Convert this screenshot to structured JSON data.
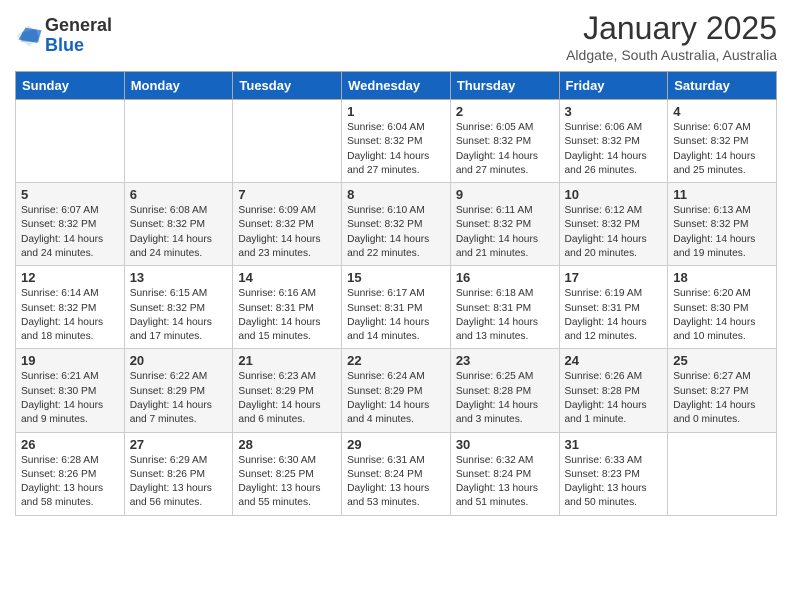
{
  "header": {
    "logo_general": "General",
    "logo_blue": "Blue",
    "month_title": "January 2025",
    "location": "Aldgate, South Australia, Australia"
  },
  "weekdays": [
    "Sunday",
    "Monday",
    "Tuesday",
    "Wednesday",
    "Thursday",
    "Friday",
    "Saturday"
  ],
  "weeks": [
    [
      {
        "day": "",
        "info": ""
      },
      {
        "day": "",
        "info": ""
      },
      {
        "day": "",
        "info": ""
      },
      {
        "day": "1",
        "info": "Sunrise: 6:04 AM\nSunset: 8:32 PM\nDaylight: 14 hours\nand 27 minutes."
      },
      {
        "day": "2",
        "info": "Sunrise: 6:05 AM\nSunset: 8:32 PM\nDaylight: 14 hours\nand 27 minutes."
      },
      {
        "day": "3",
        "info": "Sunrise: 6:06 AM\nSunset: 8:32 PM\nDaylight: 14 hours\nand 26 minutes."
      },
      {
        "day": "4",
        "info": "Sunrise: 6:07 AM\nSunset: 8:32 PM\nDaylight: 14 hours\nand 25 minutes."
      }
    ],
    [
      {
        "day": "5",
        "info": "Sunrise: 6:07 AM\nSunset: 8:32 PM\nDaylight: 14 hours\nand 24 minutes."
      },
      {
        "day": "6",
        "info": "Sunrise: 6:08 AM\nSunset: 8:32 PM\nDaylight: 14 hours\nand 24 minutes."
      },
      {
        "day": "7",
        "info": "Sunrise: 6:09 AM\nSunset: 8:32 PM\nDaylight: 14 hours\nand 23 minutes."
      },
      {
        "day": "8",
        "info": "Sunrise: 6:10 AM\nSunset: 8:32 PM\nDaylight: 14 hours\nand 22 minutes."
      },
      {
        "day": "9",
        "info": "Sunrise: 6:11 AM\nSunset: 8:32 PM\nDaylight: 14 hours\nand 21 minutes."
      },
      {
        "day": "10",
        "info": "Sunrise: 6:12 AM\nSunset: 8:32 PM\nDaylight: 14 hours\nand 20 minutes."
      },
      {
        "day": "11",
        "info": "Sunrise: 6:13 AM\nSunset: 8:32 PM\nDaylight: 14 hours\nand 19 minutes."
      }
    ],
    [
      {
        "day": "12",
        "info": "Sunrise: 6:14 AM\nSunset: 8:32 PM\nDaylight: 14 hours\nand 18 minutes."
      },
      {
        "day": "13",
        "info": "Sunrise: 6:15 AM\nSunset: 8:32 PM\nDaylight: 14 hours\nand 17 minutes."
      },
      {
        "day": "14",
        "info": "Sunrise: 6:16 AM\nSunset: 8:31 PM\nDaylight: 14 hours\nand 15 minutes."
      },
      {
        "day": "15",
        "info": "Sunrise: 6:17 AM\nSunset: 8:31 PM\nDaylight: 14 hours\nand 14 minutes."
      },
      {
        "day": "16",
        "info": "Sunrise: 6:18 AM\nSunset: 8:31 PM\nDaylight: 14 hours\nand 13 minutes."
      },
      {
        "day": "17",
        "info": "Sunrise: 6:19 AM\nSunset: 8:31 PM\nDaylight: 14 hours\nand 12 minutes."
      },
      {
        "day": "18",
        "info": "Sunrise: 6:20 AM\nSunset: 8:30 PM\nDaylight: 14 hours\nand 10 minutes."
      }
    ],
    [
      {
        "day": "19",
        "info": "Sunrise: 6:21 AM\nSunset: 8:30 PM\nDaylight: 14 hours\nand 9 minutes."
      },
      {
        "day": "20",
        "info": "Sunrise: 6:22 AM\nSunset: 8:29 PM\nDaylight: 14 hours\nand 7 minutes."
      },
      {
        "day": "21",
        "info": "Sunrise: 6:23 AM\nSunset: 8:29 PM\nDaylight: 14 hours\nand 6 minutes."
      },
      {
        "day": "22",
        "info": "Sunrise: 6:24 AM\nSunset: 8:29 PM\nDaylight: 14 hours\nand 4 minutes."
      },
      {
        "day": "23",
        "info": "Sunrise: 6:25 AM\nSunset: 8:28 PM\nDaylight: 14 hours\nand 3 minutes."
      },
      {
        "day": "24",
        "info": "Sunrise: 6:26 AM\nSunset: 8:28 PM\nDaylight: 14 hours\nand 1 minute."
      },
      {
        "day": "25",
        "info": "Sunrise: 6:27 AM\nSunset: 8:27 PM\nDaylight: 14 hours\nand 0 minutes."
      }
    ],
    [
      {
        "day": "26",
        "info": "Sunrise: 6:28 AM\nSunset: 8:26 PM\nDaylight: 13 hours\nand 58 minutes."
      },
      {
        "day": "27",
        "info": "Sunrise: 6:29 AM\nSunset: 8:26 PM\nDaylight: 13 hours\nand 56 minutes."
      },
      {
        "day": "28",
        "info": "Sunrise: 6:30 AM\nSunset: 8:25 PM\nDaylight: 13 hours\nand 55 minutes."
      },
      {
        "day": "29",
        "info": "Sunrise: 6:31 AM\nSunset: 8:24 PM\nDaylight: 13 hours\nand 53 minutes."
      },
      {
        "day": "30",
        "info": "Sunrise: 6:32 AM\nSunset: 8:24 PM\nDaylight: 13 hours\nand 51 minutes."
      },
      {
        "day": "31",
        "info": "Sunrise: 6:33 AM\nSunset: 8:23 PM\nDaylight: 13 hours\nand 50 minutes."
      },
      {
        "day": "",
        "info": ""
      }
    ]
  ]
}
